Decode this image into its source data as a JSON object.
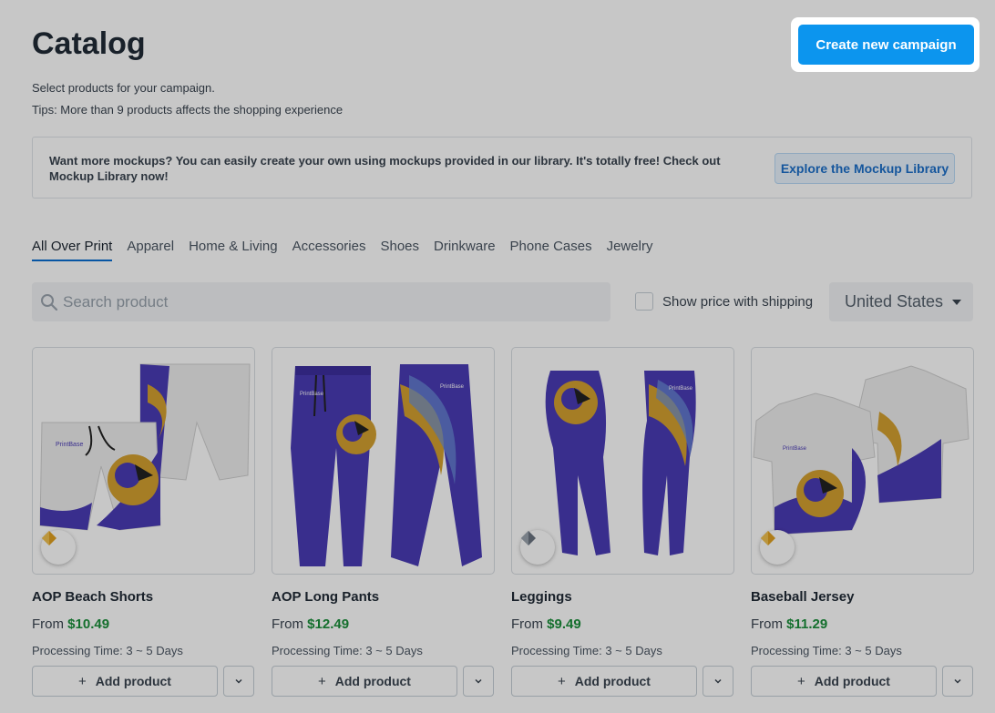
{
  "header": {
    "title": "Catalog",
    "subtitle": "Select products for your campaign.",
    "tips": "Tips: More than 9 products affects the shopping experience",
    "cta_label": "Create new campaign"
  },
  "banner": {
    "text": "Want more mockups? You can easily create your own using mockups provided in our library. It's totally free! Check out Mockup Library now!",
    "button_label": "Explore the Mockup Library"
  },
  "tabs": [
    {
      "label": "All Over Print",
      "active": true
    },
    {
      "label": "Apparel",
      "active": false
    },
    {
      "label": "Home & Living",
      "active": false
    },
    {
      "label": "Accessories",
      "active": false
    },
    {
      "label": "Shoes",
      "active": false
    },
    {
      "label": "Drinkware",
      "active": false
    },
    {
      "label": "Phone Cases",
      "active": false
    },
    {
      "label": "Jewelry",
      "active": false
    }
  ],
  "filters": {
    "search_placeholder": "Search product",
    "show_price_label": "Show price with shipping",
    "show_price_checked": false,
    "country": "United States"
  },
  "products": [
    {
      "name": "AOP Beach Shorts",
      "from": "From",
      "price": "$10.49",
      "processing": "Processing Time: 3 ~ 5 Days",
      "add_label": "Add product",
      "badge": "gold"
    },
    {
      "name": "AOP Long Pants",
      "from": "From",
      "price": "$12.49",
      "processing": "Processing Time: 3 ~ 5 Days",
      "add_label": "Add product",
      "badge": "none"
    },
    {
      "name": "Leggings",
      "from": "From",
      "price": "$9.49",
      "processing": "Processing Time: 3 ~ 5 Days",
      "add_label": "Add product",
      "badge": "silver"
    },
    {
      "name": "Baseball Jersey",
      "from": "From",
      "price": "$11.29",
      "processing": "Processing Time: 3 ~ 5 Days",
      "add_label": "Add product",
      "badge": "gold"
    }
  ],
  "colors": {
    "accent": "#0c95ee",
    "price": "#1a8f3a",
    "garment_purple": "#4a3bb5",
    "garment_white": "#eeeeee",
    "bird_gold": "#d4a030",
    "overlay": "rgba(0,0,0,0.22)"
  }
}
